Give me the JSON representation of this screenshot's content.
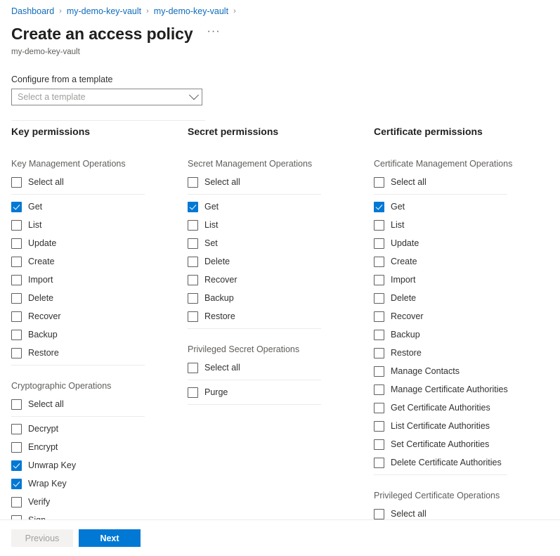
{
  "breadcrumb": {
    "items": [
      "Dashboard",
      "my-demo-key-vault",
      "my-demo-key-vault"
    ],
    "separator": "›"
  },
  "header": {
    "title": "Create an access policy",
    "subtitle": "my-demo-key-vault",
    "more_menu": "···"
  },
  "template": {
    "label": "Configure from a template",
    "placeholder": "Select a template",
    "value": ""
  },
  "columns": [
    {
      "heading": "Key permissions",
      "groups": [
        {
          "label": "Key Management Operations",
          "select_all": "Select all",
          "select_all_checked": false,
          "items": [
            {
              "label": "Get",
              "checked": true
            },
            {
              "label": "List",
              "checked": false
            },
            {
              "label": "Update",
              "checked": false
            },
            {
              "label": "Create",
              "checked": false
            },
            {
              "label": "Import",
              "checked": false
            },
            {
              "label": "Delete",
              "checked": false
            },
            {
              "label": "Recover",
              "checked": false
            },
            {
              "label": "Backup",
              "checked": false
            },
            {
              "label": "Restore",
              "checked": false
            }
          ]
        },
        {
          "label": "Cryptographic Operations",
          "select_all": "Select all",
          "select_all_checked": false,
          "items": [
            {
              "label": "Decrypt",
              "checked": false
            },
            {
              "label": "Encrypt",
              "checked": false
            },
            {
              "label": "Unwrap Key",
              "checked": true
            },
            {
              "label": "Wrap Key",
              "checked": true
            },
            {
              "label": "Verify",
              "checked": false
            },
            {
              "label": "Sign",
              "checked": false
            }
          ]
        }
      ]
    },
    {
      "heading": "Secret permissions",
      "groups": [
        {
          "label": "Secret Management Operations",
          "select_all": "Select all",
          "select_all_checked": false,
          "items": [
            {
              "label": "Get",
              "checked": true
            },
            {
              "label": "List",
              "checked": false
            },
            {
              "label": "Set",
              "checked": false
            },
            {
              "label": "Delete",
              "checked": false
            },
            {
              "label": "Recover",
              "checked": false
            },
            {
              "label": "Backup",
              "checked": false
            },
            {
              "label": "Restore",
              "checked": false
            }
          ]
        },
        {
          "label": "Privileged Secret Operations",
          "select_all": "Select all",
          "select_all_checked": false,
          "items": [
            {
              "label": "Purge",
              "checked": false
            }
          ]
        }
      ]
    },
    {
      "heading": "Certificate permissions",
      "groups": [
        {
          "label": "Certificate Management Operations",
          "select_all": "Select all",
          "select_all_checked": false,
          "items": [
            {
              "label": "Get",
              "checked": true
            },
            {
              "label": "List",
              "checked": false
            },
            {
              "label": "Update",
              "checked": false
            },
            {
              "label": "Create",
              "checked": false
            },
            {
              "label": "Import",
              "checked": false
            },
            {
              "label": "Delete",
              "checked": false
            },
            {
              "label": "Recover",
              "checked": false
            },
            {
              "label": "Backup",
              "checked": false
            },
            {
              "label": "Restore",
              "checked": false
            },
            {
              "label": "Manage Contacts",
              "checked": false
            },
            {
              "label": "Manage Certificate Authorities",
              "checked": false
            },
            {
              "label": "Get Certificate Authorities",
              "checked": false
            },
            {
              "label": "List Certificate Authorities",
              "checked": false
            },
            {
              "label": "Set Certificate Authorities",
              "checked": false
            },
            {
              "label": "Delete Certificate Authorities",
              "checked": false
            }
          ]
        },
        {
          "label": "Privileged Certificate Operations",
          "select_all": "Select all",
          "select_all_checked": false,
          "items": []
        }
      ]
    }
  ],
  "footer": {
    "previous_label": "Previous",
    "next_label": "Next",
    "previous_enabled": false
  },
  "colors": {
    "accent": "#0078d4",
    "link": "#0f6cbd",
    "text": "#323130",
    "muted": "#605e5c"
  }
}
